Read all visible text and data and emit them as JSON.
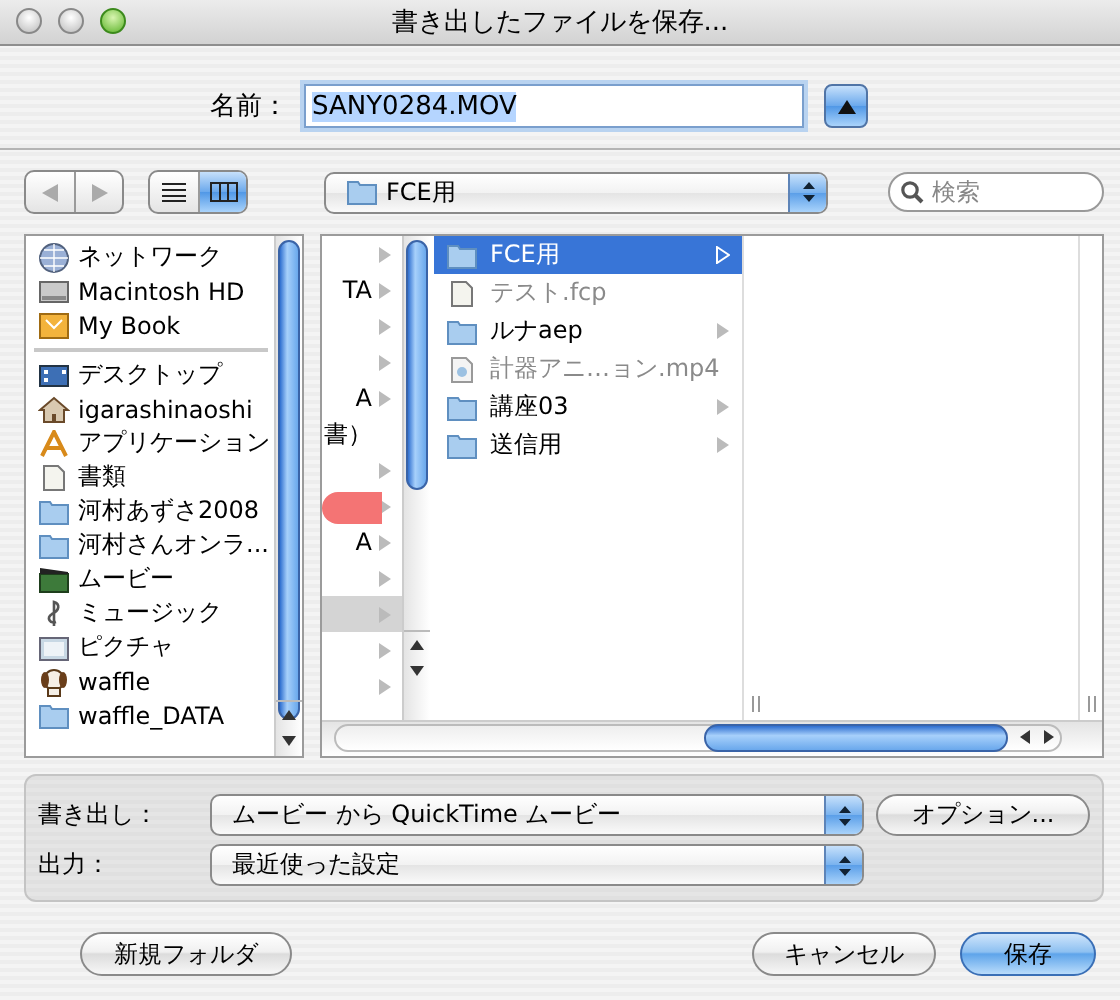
{
  "window": {
    "title": "書き出したファイルを保存..."
  },
  "name_field": {
    "label": "名前：",
    "value": "SANY0284.MOV",
    "text_selected": true
  },
  "history_buttons": [
    {
      "kind": "back",
      "disabled": true
    },
    {
      "kind": "forward",
      "disabled": true
    }
  ],
  "view_buttons": [
    {
      "kind": "list",
      "selected": false
    },
    {
      "kind": "columns",
      "selected": true
    }
  ],
  "location_popup": {
    "value": "FCE用"
  },
  "search": {
    "placeholder": "検索"
  },
  "sidebar": {
    "sections": [
      {
        "items": [
          {
            "label": "ネットワーク",
            "kind": "network"
          },
          {
            "label": "Macintosh HD",
            "kind": "disk"
          },
          {
            "label": "My Book",
            "kind": "external"
          }
        ]
      },
      {
        "items": [
          {
            "label": "デスクトップ",
            "kind": "desktop"
          },
          {
            "label": "igarashinaoshi",
            "kind": "home"
          },
          {
            "label": "アプリケーション",
            "kind": "apps"
          },
          {
            "label": "書類",
            "kind": "document"
          },
          {
            "label": "河村あずさ2008",
            "kind": "folder"
          },
          {
            "label": "河村さんオンラ...",
            "kind": "folder"
          },
          {
            "label": "ムービー",
            "kind": "movies"
          },
          {
            "label": "ミュージック",
            "kind": "music"
          },
          {
            "label": "ピクチャ",
            "kind": "pictures"
          },
          {
            "label": "waffle",
            "kind": "dog"
          },
          {
            "label": "waffle_DATA",
            "kind": "folder"
          }
        ]
      }
    ]
  },
  "columns": [
    {
      "rows": [
        {
          "selected": false,
          "has_children": true
        },
        {
          "text": "TA",
          "selected": false,
          "has_children": true
        },
        {
          "selected": false,
          "has_children": true
        },
        {
          "selected": false,
          "has_children": true
        },
        {
          "text": "A",
          "selected": false,
          "has_children": true
        },
        {
          "text": "書）",
          "selected": false,
          "has_children": false
        },
        {
          "selected": false,
          "has_children": true
        },
        {
          "selected": false,
          "has_children": true,
          "color": "#f47474"
        },
        {
          "text": "A",
          "selected": false,
          "has_children": true
        },
        {
          "selected": false,
          "has_children": true
        },
        {
          "selected": true,
          "has_children": true
        },
        {
          "selected": false,
          "has_children": true
        },
        {
          "selected": false,
          "has_children": true
        }
      ]
    },
    {
      "rows": [
        {
          "text": "FCE用",
          "kind": "folder",
          "selected": true,
          "disabled": false,
          "has_children": true
        },
        {
          "text": "テスト.fcp",
          "kind": "document",
          "selected": false,
          "disabled": true,
          "has_children": false
        },
        {
          "text": "ルナaep",
          "kind": "folder",
          "selected": false,
          "disabled": false,
          "has_children": true
        },
        {
          "text": "計器アニ…ョン.mp4",
          "kind": "movie",
          "selected": false,
          "disabled": true,
          "has_children": false
        },
        {
          "text": "講座03",
          "kind": "folder",
          "selected": false,
          "disabled": false,
          "has_children": true
        },
        {
          "text": "送信用",
          "kind": "folder",
          "selected": false,
          "disabled": false,
          "has_children": true
        }
      ]
    }
  ],
  "export": {
    "label": "書き出し：",
    "value": "ムービー から QuickTime ムービー"
  },
  "options_button": {
    "label": "オプション..."
  },
  "output": {
    "label": "出力：",
    "value": "最近使った設定"
  },
  "buttons": [
    {
      "label": "新規フォルダ",
      "kind": "normal"
    },
    {
      "label": "キャンセル",
      "kind": "normal"
    },
    {
      "label": "保存",
      "kind": "default"
    }
  ]
}
